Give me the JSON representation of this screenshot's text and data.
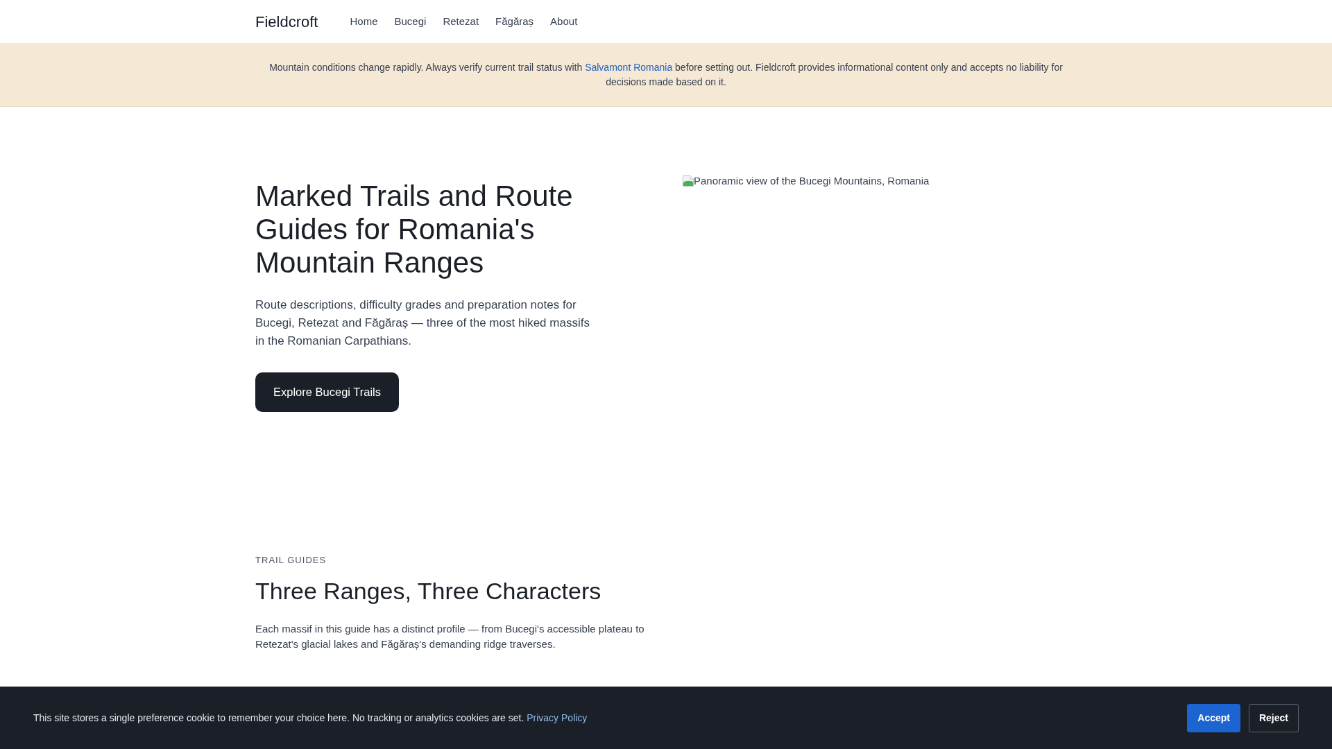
{
  "header": {
    "logo": "Fieldcroft",
    "nav": [
      {
        "label": "Home"
      },
      {
        "label": "Bucegi"
      },
      {
        "label": "Retezat"
      },
      {
        "label": "Făgăraș"
      },
      {
        "label": "About"
      }
    ]
  },
  "notice": {
    "text_before": "Mountain conditions change rapidly. Always verify current trail status with",
    "link": "Salvamont Romania",
    "text_after": "before setting out. Fieldcroft provides informational content only and accepts no liability for decisions made based on it."
  },
  "hero": {
    "title": "Marked Trails and Route Guides for Romania's Mountain Ranges",
    "description": "Route descriptions, difficulty grades and preparation notes for Bucegi, Retezat and Făgăraș — three of the most hiked massifs in the Romanian Carpathians.",
    "cta": "Explore Bucegi Trails",
    "image": {
      "alt": "Panoramic view of the Bucegi Mountains, Romania"
    }
  },
  "trail_guides": {
    "eyebrow": "TRAIL GUIDES",
    "title": "Three Ranges, Three Characters",
    "description": "Each massif in this guide has a distinct profile — from Bucegi's accessible plateau to Retezat's glacial lakes and Făgăraș's demanding ridge traverses."
  },
  "cookie_banner": {
    "text": "This site stores a single preference cookie to remember your choice here. No tracking or analytics cookies are set.",
    "link": "Privacy Policy",
    "buttons": [
      {
        "label": "Accept",
        "kind": "primary"
      },
      {
        "label": "Reject",
        "kind": "secondary"
      }
    ]
  }
}
